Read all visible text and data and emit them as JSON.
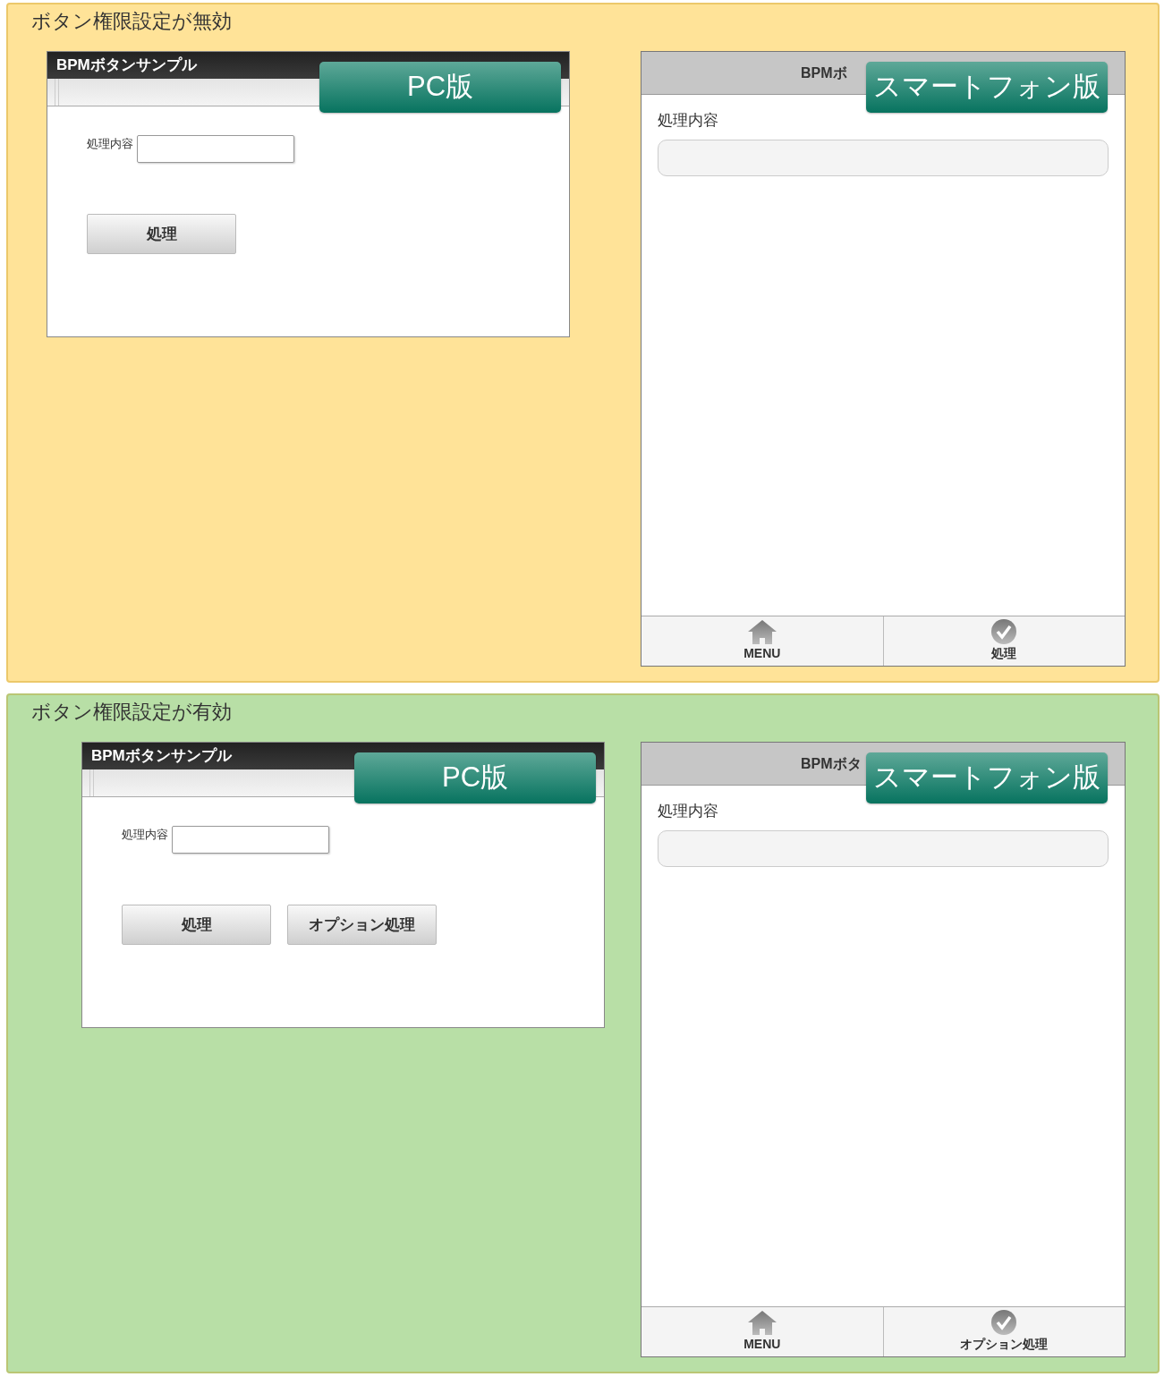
{
  "sections": [
    {
      "title": "ボタン権限設定が無効",
      "color": "#ffe398",
      "pc": {
        "app_title": "BPMボタンサンプル",
        "badge": "PC版",
        "field_label": "処理内容",
        "buttons": [
          "処理"
        ]
      },
      "phone": {
        "header_title": "BPMボ",
        "badge": "スマートフォン版",
        "field_label": "処理内容",
        "footer": [
          {
            "kind": "home",
            "label": "MENU"
          },
          {
            "kind": "check",
            "label": "処理"
          }
        ]
      }
    },
    {
      "title": "ボタン権限設定が有効",
      "color": "#b8dfa6",
      "pc": {
        "app_title": "BPMボタンサンプル",
        "badge": "PC版",
        "field_label": "処理内容",
        "buttons": [
          "処理",
          "オプション処理"
        ]
      },
      "phone": {
        "header_title": "BPMボタ",
        "badge": "スマートフォン版",
        "field_label": "処理内容",
        "footer": [
          {
            "kind": "home",
            "label": "MENU"
          },
          {
            "kind": "check",
            "label": "オプション処理"
          }
        ]
      }
    }
  ]
}
